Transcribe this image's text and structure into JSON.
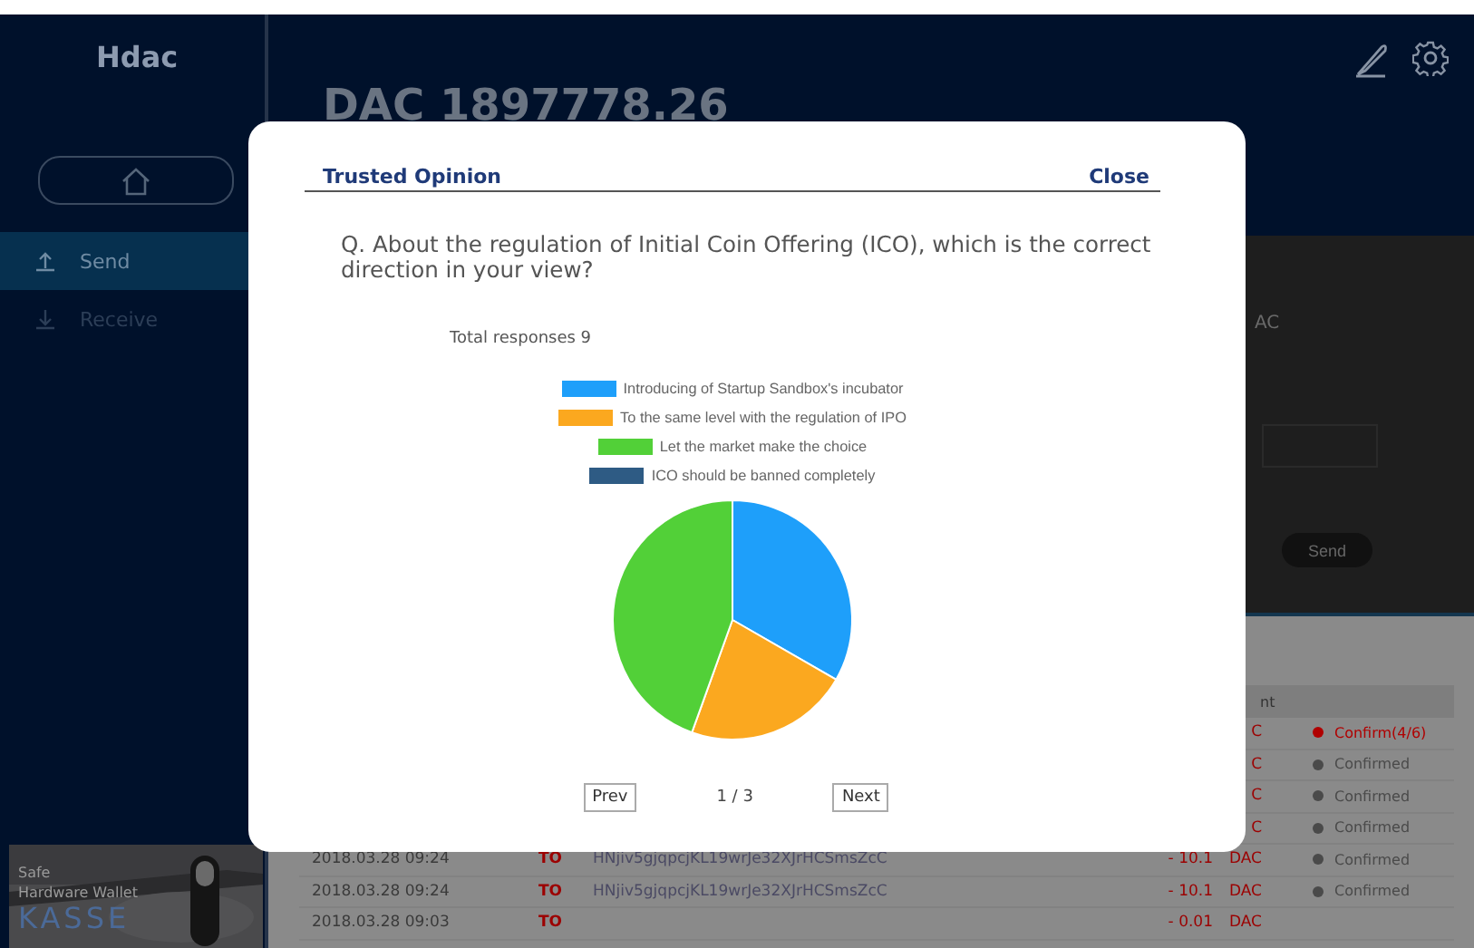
{
  "sidebar": {
    "logo": "Hdac",
    "items": [
      {
        "label": "Send",
        "selected": true
      },
      {
        "label": "Receive",
        "selected": false
      }
    ],
    "ad": {
      "kind": "picture",
      "lines": [
        "Safe",
        "Hardware Wallet"
      ],
      "brand": "KASSE"
    }
  },
  "header": {
    "balance": "DAC 1897778.26"
  },
  "send_form": {
    "unit": "AC",
    "button": "Send"
  },
  "transactions": {
    "columns": [
      "nt"
    ],
    "rows": [
      {
        "currency": "C",
        "status": "Confirm(4/6)",
        "color": "#b00000"
      },
      {
        "currency": "C",
        "status": "Confirmed",
        "color": "#4a4a4a"
      },
      {
        "currency": "C",
        "status": "Confirmed",
        "color": "#4a4a4a"
      },
      {
        "currency": "C",
        "status": "Confirmed",
        "color": "#4a4a4a"
      },
      {
        "date": "2018.03.28 09:24",
        "type": "TO",
        "address": "HNjiv5gjqpcjKL19wrJe32XJrHCSmsZcC",
        "amount": "- 10.1",
        "currency": "DAC",
        "status": "Confirmed",
        "color": "#4a4a4a"
      },
      {
        "date": "2018.03.28 09:24",
        "type": "TO",
        "address": "HNjiv5gjqpcjKL19wrJe32XJrHCSmsZcC",
        "amount": "- 10.1",
        "currency": "DAC",
        "status": "Confirmed",
        "color": "#4a4a4a"
      },
      {
        "date": "2018.03.28 09:03",
        "type": "TO",
        "amount": "- 0.01",
        "currency": "DAC"
      }
    ]
  },
  "dialog": {
    "title": "Trusted Opinion",
    "close": "Close",
    "question": "Q. About the regulation of Initial Coin Offering (ICO), which is the correct direction in your view?",
    "total": "Total responses 9",
    "chart_data": {
      "type": "pie",
      "legend": "top",
      "categories": [
        "Introducing of Startup Sandbox's incubator",
        "To the same level with the regulation of IPO",
        "Let the market make the choice",
        "ICO should be banned completely"
      ],
      "colors": [
        "#1e9ffa",
        "#fba81f",
        "#52d038",
        "#2e5b84"
      ],
      "series": [
        {
          "values": [
            33.3,
            22.2,
            44.5,
            0
          ]
        }
      ]
    },
    "pager": {
      "prev": "Prev",
      "page": "1 / 3",
      "next": "Next"
    }
  }
}
